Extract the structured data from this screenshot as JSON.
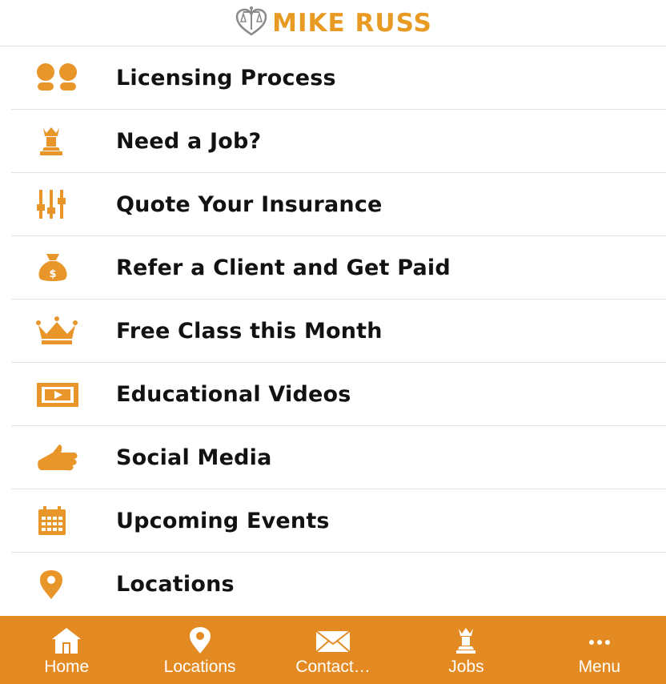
{
  "app": {
    "brand": "MIKE RUSS",
    "accent_color": "#e89a22",
    "tabbar_color": "#e38b22"
  },
  "menu": {
    "items": [
      {
        "label": "Licensing Process",
        "icon": "footprints-icon"
      },
      {
        "label": "Need a Job?",
        "icon": "chess-queen-icon"
      },
      {
        "label": "Quote Your Insurance",
        "icon": "sliders-icon"
      },
      {
        "label": "Refer a Client and Get Paid",
        "icon": "money-bag-icon"
      },
      {
        "label": "Free Class this Month",
        "icon": "crown-icon"
      },
      {
        "label": "Educational Videos",
        "icon": "video-player-icon"
      },
      {
        "label": "Social Media",
        "icon": "thumbs-up-icon"
      },
      {
        "label": "Upcoming Events",
        "icon": "calendar-icon"
      },
      {
        "label": "Locations",
        "icon": "map-pin-icon"
      }
    ]
  },
  "tabbar": {
    "tabs": [
      {
        "label": "Home",
        "icon": "home-icon"
      },
      {
        "label": "Locations",
        "icon": "map-pin-icon"
      },
      {
        "label": "Contact…",
        "icon": "envelope-icon"
      },
      {
        "label": "Jobs",
        "icon": "chess-queen-icon"
      },
      {
        "label": "Menu",
        "icon": "more-dots-icon"
      }
    ]
  }
}
